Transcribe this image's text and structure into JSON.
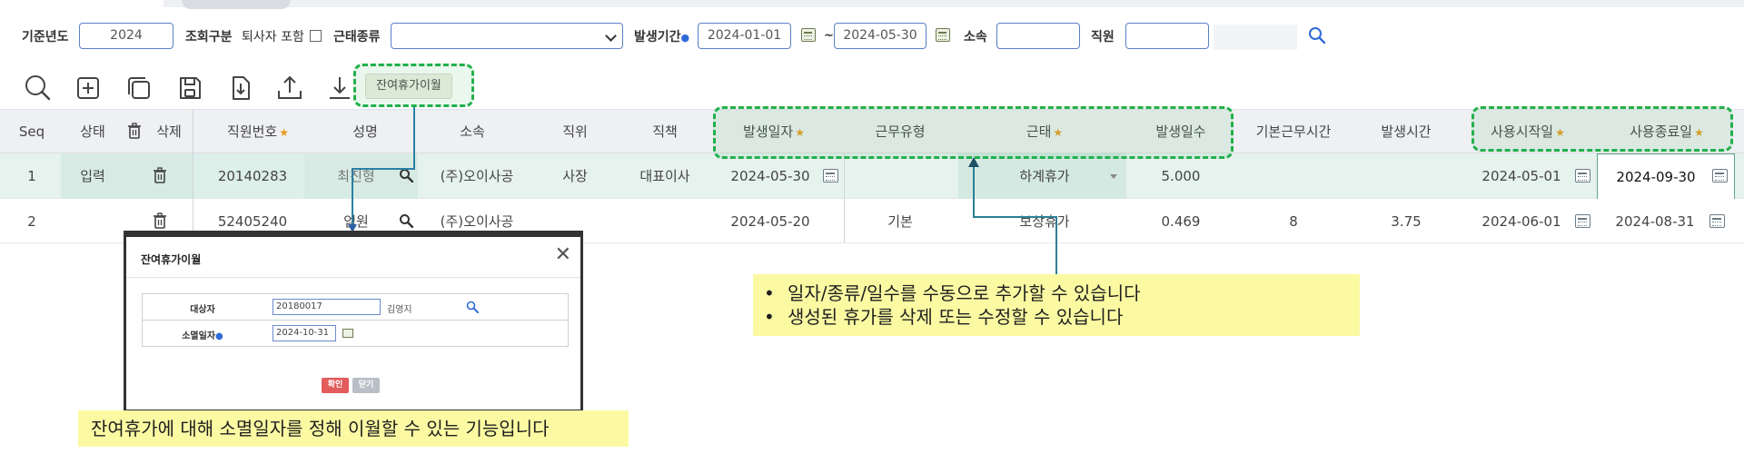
{
  "filters": {
    "year_label": "기준년도",
    "year_value": "2024",
    "query_label": "조회구분",
    "include_retired_label": "퇴사자 포함",
    "leave_type_label": "근태종류",
    "leave_type_value": "",
    "period_label": "발생기간",
    "period_from": "2024-01-01",
    "period_sep": "~",
    "period_to": "2024-05-30",
    "dept_label": "소속",
    "dept_value": "",
    "employee_label": "직원",
    "employee_value": "",
    "required_marker": "●"
  },
  "toolbar": {
    "icons": [
      "search-icon",
      "add-icon",
      "copy-icon",
      "save-icon",
      "import-icon",
      "upload-icon",
      "download-icon"
    ],
    "carryover_button": "잔여휴가이월"
  },
  "grid": {
    "columns": {
      "seq": "Seq",
      "status": "상태",
      "delete": "삭제",
      "emp_no": "직원번호",
      "name": "성명",
      "dept": "소속",
      "position": "직위",
      "title": "직책",
      "occur_date": "발생일자",
      "work_type": "근무유형",
      "leave": "근태",
      "occur_days": "발생일수",
      "base_hours": "기본근무시간",
      "occur_hours": "발생시간",
      "use_start": "사용시작일",
      "use_end": "사용종료일"
    },
    "required_star": "★",
    "rows": [
      {
        "seq": "1",
        "status": "입력",
        "emp_no": "20140283",
        "name": "최진형",
        "dept": "(주)오이사공",
        "position": "사장",
        "title": "대표이사",
        "occur_date": "2024-05-30",
        "work_type": "",
        "leave": "하계휴가",
        "occur_days": "5.000",
        "base_hours": "",
        "occur_hours": "",
        "use_start": "2024-05-01",
        "use_end": "2024-09-30"
      },
      {
        "seq": "2",
        "status": "",
        "emp_no": "52405240",
        "name": "엄원",
        "dept": "(주)오이사공",
        "position": "",
        "title": "",
        "occur_date": "2024-05-20",
        "work_type": "기본",
        "leave": "보상휴가",
        "occur_days": "0.469",
        "base_hours": "8",
        "occur_hours": "3.75",
        "use_start": "2024-06-01",
        "use_end": "2024-08-31"
      }
    ]
  },
  "dialog": {
    "title": "잔여휴가이월",
    "target_label": "대상자",
    "target_value": "20180017",
    "target_name": "김영지",
    "expire_label": "소멸일자",
    "expire_value": "2024-10-31",
    "ok_label": "확인",
    "close_label": "닫기"
  },
  "notes": {
    "right_bullets": [
      "일자/종류/일수를 수동으로 추가할 수 있습니다",
      "생성된 휴가를 삭제 또는 수정할 수 있습니다"
    ],
    "bullet": "•",
    "left": "잔여휴가에 대해 소멸일자를 정해 이월할 수 있는 기능입니다"
  },
  "colors": {
    "highlight": "#21b04b",
    "note_bg": "#fbfaa3",
    "selected_row": "#e6f2ee",
    "input_border": "#5b7fc9",
    "required_star": "#e59a1f",
    "connector": "#2c7fa4"
  }
}
